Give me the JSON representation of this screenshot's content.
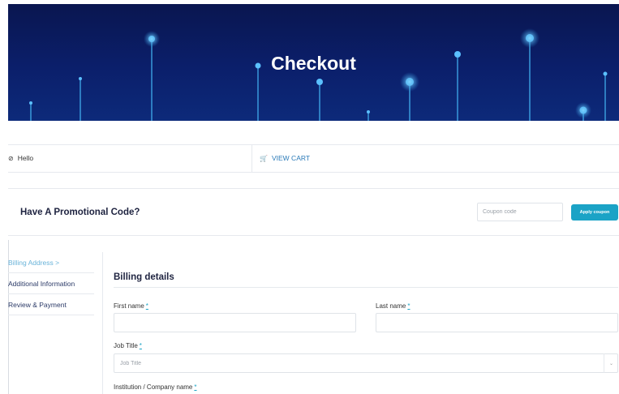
{
  "page": {
    "title": "Checkout"
  },
  "account_bar": {
    "greeting": "Hello",
    "greeting_icon": "user-circle-icon",
    "view_cart": "VIEW CART",
    "cart_icon": "cart-icon"
  },
  "promo": {
    "title": "Have A Promotional Code?",
    "coupon_placeholder": "Coupon code",
    "apply_label": "Apply coupon"
  },
  "steps": [
    {
      "label": "Billing Address >",
      "active": true
    },
    {
      "label": "Additional Information",
      "active": false
    },
    {
      "label": "Review & Payment",
      "active": false
    }
  ],
  "billing": {
    "title": "Billing details",
    "first_name": {
      "label": "First name",
      "required": "*",
      "value": ""
    },
    "last_name": {
      "label": "Last name",
      "required": "*",
      "value": ""
    },
    "job_title": {
      "label": "Job Title",
      "required": "*",
      "placeholder": "Job Title"
    },
    "institution": {
      "label": "Institution / Company name",
      "required": "*"
    }
  },
  "colors": {
    "accent": "#1ba3c6",
    "hero_bg": "#0b1f6b",
    "link": "#2a7ab8",
    "active_step": "#69b3d9"
  }
}
